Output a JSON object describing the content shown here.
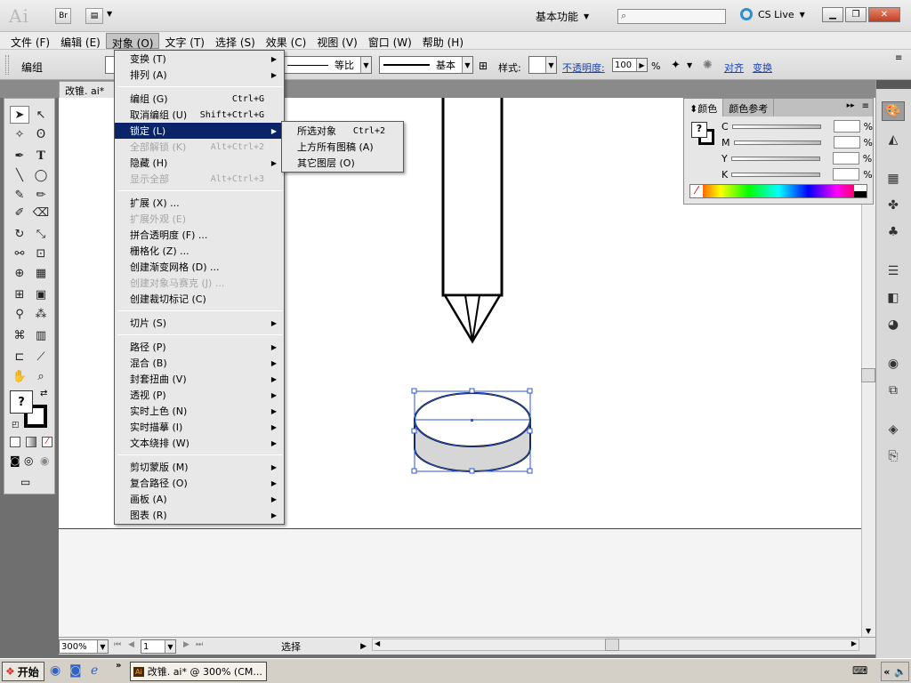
{
  "app": {
    "logo": "Ai",
    "bridge_label": "Br",
    "workspace_label": "基本功能",
    "cslive_label": "CS Live",
    "colors": {
      "menu_highlight": "#0a246a",
      "link": "#1a44b8"
    }
  },
  "menubar": [
    {
      "label": "文件 (F)"
    },
    {
      "label": "编辑 (E)"
    },
    {
      "label": "对象 (O)"
    },
    {
      "label": "文字 (T)"
    },
    {
      "label": "选择 (S)"
    },
    {
      "label": "效果 (C)"
    },
    {
      "label": "视图 (V)"
    },
    {
      "label": "窗口 (W)"
    },
    {
      "label": "帮助 (H)"
    }
  ],
  "controlbar": {
    "label": "编组",
    "stroke_scale": "等比",
    "stroke_style": "基本",
    "style_label": "样式:",
    "opacity_label": "不透明度:",
    "opacity_value": "100",
    "opacity_unit": "%",
    "align_link": "对齐",
    "transform_link": "变换"
  },
  "document": {
    "tab_label": "改锥. ai*",
    "zoom": "300%",
    "artboard": "1",
    "status": "选择"
  },
  "object_menu": [
    {
      "label": "变换 (T)",
      "shortcut": "",
      "submenu": true,
      "disabled": false
    },
    {
      "label": "排列 (A)",
      "shortcut": "",
      "submenu": true,
      "disabled": false
    },
    {
      "label": "编组 (G)",
      "shortcut": "Ctrl+G",
      "submenu": false,
      "disabled": false
    },
    {
      "label": "取消编组 (U)",
      "shortcut": "Shift+Ctrl+G",
      "submenu": false,
      "disabled": false
    },
    {
      "label": "锁定 (L)",
      "shortcut": "",
      "submenu": true,
      "disabled": false
    },
    {
      "label": "全部解锁 (K)",
      "shortcut": "Alt+Ctrl+2",
      "submenu": false,
      "disabled": true
    },
    {
      "label": "隐藏 (H)",
      "shortcut": "",
      "submenu": true,
      "disabled": false
    },
    {
      "label": "显示全部",
      "shortcut": "Alt+Ctrl+3",
      "submenu": false,
      "disabled": true
    },
    {
      "label": "扩展 (X) ...",
      "shortcut": "",
      "submenu": false,
      "disabled": false
    },
    {
      "label": "扩展外观 (E)",
      "shortcut": "",
      "submenu": false,
      "disabled": true
    },
    {
      "label": "拼合透明度 (F) ...",
      "shortcut": "",
      "submenu": false,
      "disabled": false
    },
    {
      "label": "栅格化 (Z) ...",
      "shortcut": "",
      "submenu": false,
      "disabled": false
    },
    {
      "label": "创建渐变网格 (D) ...",
      "shortcut": "",
      "submenu": false,
      "disabled": false
    },
    {
      "label": "创建对象马赛克 (J) ...",
      "shortcut": "",
      "submenu": false,
      "disabled": true
    },
    {
      "label": "创建裁切标记 (C)",
      "shortcut": "",
      "submenu": false,
      "disabled": false
    },
    {
      "label": "切片 (S)",
      "shortcut": "",
      "submenu": true,
      "disabled": false
    },
    {
      "label": "路径 (P)",
      "shortcut": "",
      "submenu": true,
      "disabled": false
    },
    {
      "label": "混合 (B)",
      "shortcut": "",
      "submenu": true,
      "disabled": false
    },
    {
      "label": "封套扭曲 (V)",
      "shortcut": "",
      "submenu": true,
      "disabled": false
    },
    {
      "label": "透视 (P)",
      "shortcut": "",
      "submenu": true,
      "disabled": false
    },
    {
      "label": "实时上色 (N)",
      "shortcut": "",
      "submenu": true,
      "disabled": false
    },
    {
      "label": "实时描摹 (I)",
      "shortcut": "",
      "submenu": true,
      "disabled": false
    },
    {
      "label": "文本绕排 (W)",
      "shortcut": "",
      "submenu": true,
      "disabled": false
    },
    {
      "label": "剪切蒙版 (M)",
      "shortcut": "",
      "submenu": true,
      "disabled": false
    },
    {
      "label": "复合路径 (O)",
      "shortcut": "",
      "submenu": true,
      "disabled": false
    },
    {
      "label": "画板 (A)",
      "shortcut": "",
      "submenu": true,
      "disabled": false
    },
    {
      "label": "图表 (R)",
      "shortcut": "",
      "submenu": true,
      "disabled": false
    }
  ],
  "lock_submenu": [
    {
      "label": "所选对象",
      "shortcut": "Ctrl+2"
    },
    {
      "label": "上方所有图稿 (A)",
      "shortcut": ""
    },
    {
      "label": "其它图层 (O)",
      "shortcut": ""
    }
  ],
  "color_panel": {
    "tabs": [
      "颜色",
      "颜色参考"
    ],
    "channels": [
      "C",
      "M",
      "Y",
      "K"
    ],
    "unit": "%"
  },
  "taskbar": {
    "start": "开始",
    "task_item": "改锥. ai* @ 300% (CM..."
  }
}
